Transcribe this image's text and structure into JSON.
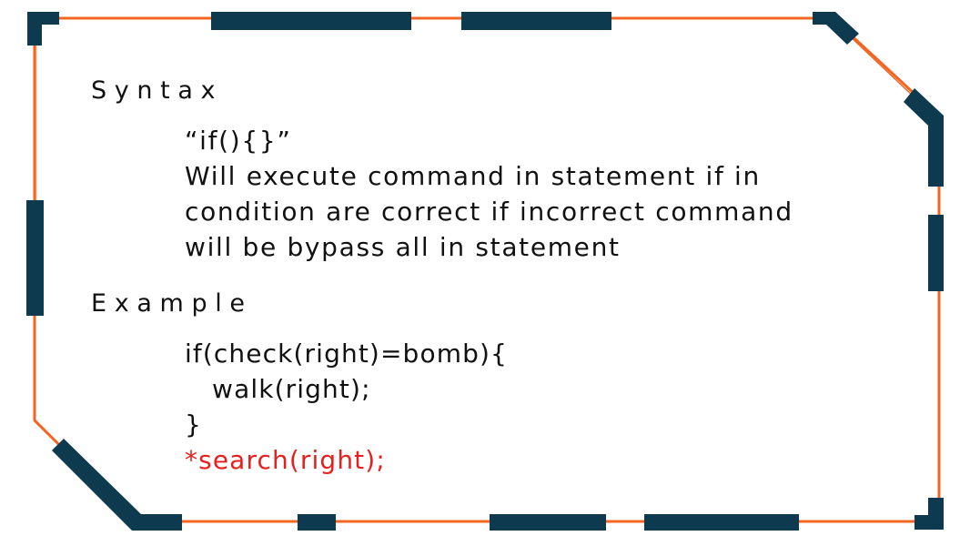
{
  "colors": {
    "accent": "#F26522",
    "dark": "#0E3A4F",
    "highlight": "#E51F1F"
  },
  "syntax": {
    "heading": "Syntax",
    "lines": [
      "“if(){}”",
      "Will execute command in statement if in",
      "condition are correct if incorrect command",
      "will be bypass all in statement"
    ]
  },
  "example": {
    "heading": "Example",
    "code": [
      "if(check(right)=bomb){",
      "   walk(right);",
      "}"
    ],
    "highlight_line": "*search(right);"
  }
}
